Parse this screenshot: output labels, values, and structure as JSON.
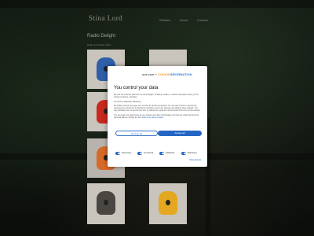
{
  "site": {
    "title": "Stina Lord"
  },
  "nav": [
    "Shiteles",
    "About",
    "Contact"
  ],
  "page": {
    "heading": "Radio Delight",
    "subheading": "Radio and Radio 2023"
  },
  "modal": {
    "brand": "one.com",
    "brand_sep": "+",
    "brand2_a": "COOKIE",
    "brand2_b": "INFORMATION",
    "title": "You control your data",
    "intro": "We and our business partners use technologies, including cookies, to collect information about you for various purposes, including:",
    "purposes": "Functional, Statistical, Marketing",
    "details": "By clicking 'Accept' you give your consent for all these purposes. You can also choose to specify the purposes you consent to by ticking the checkbox next to the purpose and clicking 'Save settings'. You may withdraw your consent at any time by clicking the small icon at the bottom left corner of the website.",
    "more": "You can read more about how we use cookies and other technologies and how we collect and process personal data by clicking the link.",
    "read_more_link": "Read more about cookies",
    "decline_label": "Decline all",
    "accept_label": "Accept all",
    "toggles": [
      {
        "label": "Necessary",
        "on": true
      },
      {
        "label": "Functional",
        "on": true
      },
      {
        "label": "Statistical",
        "on": true
      },
      {
        "label": "Marketing",
        "on": true
      }
    ],
    "show_more": "Show details"
  },
  "colors": {
    "accept": "#2466c5",
    "tile1": "#2e5fa8",
    "tile2": "#c9281f",
    "tile3": "#4a4642",
    "tile4": "#e3a820"
  }
}
